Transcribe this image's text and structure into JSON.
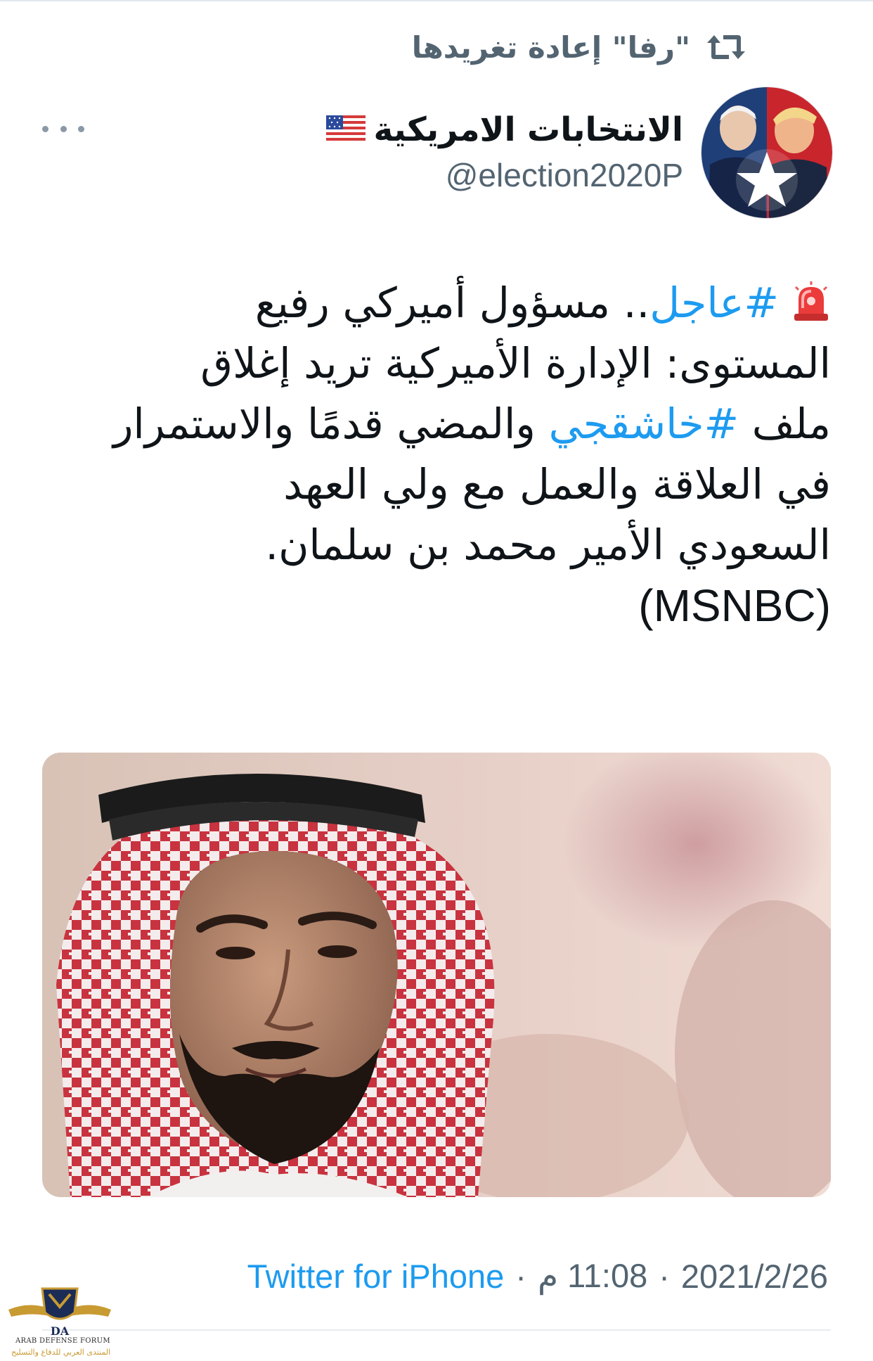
{
  "retweet": {
    "label": "\"رفا\" إعادة تغريدها",
    "icon": "retweet-icon"
  },
  "author": {
    "display_name": "الانتخابات الامريكية",
    "flag_emoji": "us-flag",
    "handle": "@election2020P",
    "avatar": "avatar-image"
  },
  "tweet": {
    "lines": [
      {
        "prefix_emoji": "siren",
        "hashtag": "#عاجل",
        "rest": ".. مسؤول أميركي رفيع"
      },
      {
        "text": "المستوى: الإدارة الأميركية تريد إغلاق"
      },
      {
        "before": "ملف ",
        "hashtag": "#خاشقجي",
        "after": " والمضي قدمًا والاستمرار"
      },
      {
        "text": "في العلاقة والعمل مع ولي العهد"
      },
      {
        "text": "السعودي الأمير محمد بن سلمان."
      },
      {
        "text": "(MSNBC)"
      }
    ],
    "hashtag_color": "#1d9bf0"
  },
  "media": {
    "kind": "photo",
    "subject": "portrait-photo"
  },
  "meta": {
    "date": "2021/2/26",
    "separator": "·",
    "time": "11:08 م",
    "source": "Twitter for iPhone"
  },
  "watermark": {
    "line1": "ARAB DEFENSE FORUM",
    "line2": "المنتدى العربي للدفاع والتسليح"
  },
  "colors": {
    "text": "#0f1419",
    "secondary": "#536471",
    "link": "#1d9bf0",
    "background": "#ffffff"
  }
}
